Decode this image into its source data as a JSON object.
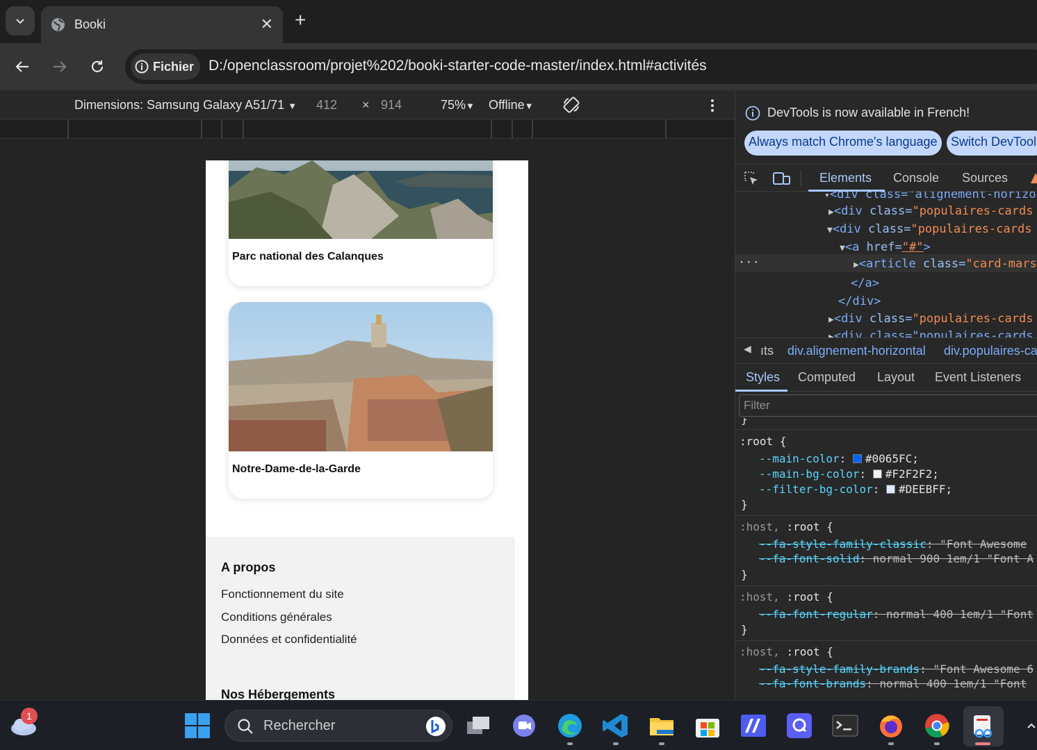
{
  "browser": {
    "tab_title": "Booki",
    "chip_label": "Fichier",
    "url": "D:/openclassroom/projet%202/booki-starter-code-master/index.html#activités"
  },
  "device_toolbar": {
    "dimensions_label": "Dimensions: Samsung Galaxy A51/71",
    "width": "412",
    "times": "×",
    "height": "914",
    "zoom": "75%",
    "throttle": "Offline"
  },
  "page": {
    "cards": [
      {
        "name": "Parc national des Calanques"
      },
      {
        "name": "Notre-Dame-de-la-Garde"
      }
    ],
    "footer": {
      "heading1": "A propos",
      "links": [
        "Fonctionnement du site",
        "Conditions générales",
        "Données et confidentialité"
      ],
      "heading2": "Nos Hébergements"
    }
  },
  "devtools": {
    "info_message": "DevTools is now available in French!",
    "btn_match": "Always match Chrome's language",
    "btn_switch": "Switch DevTools",
    "tabs": [
      "Elements",
      "Console",
      "Sources"
    ],
    "elements": {
      "line0": "<div class=\"alignement-horizont",
      "line1_tag": "<div",
      "line1_attr": "class=",
      "line1_val": "\"populaires-cards",
      "line2_val": "\"populaires-cards",
      "line3_tag": "<a",
      "line3_attr": "href=",
      "line3_val": "\"#\"",
      "line3_end": ">",
      "line4_tag": "<article",
      "line4_val": "\"card-marse",
      "line5": "</a>",
      "line6": "</div>",
      "line7_val": "\"populaires-cards",
      "line8": "<div class=\"populaires-cards"
    },
    "breadcrumbs": [
      "ıts",
      "div.alignement-horizontal",
      "div.populaires-ca"
    ],
    "subtabs": [
      "Styles",
      "Computed",
      "Layout",
      "Event Listeners"
    ],
    "filter_placeholder": "Filter",
    "styles": {
      "brace_top": "}",
      "root_selector": ":root {",
      "vars": [
        {
          "name": "--main-color",
          "value": "#0065FC",
          "color": "#0065FC"
        },
        {
          "name": "--main-bg-color",
          "value": "#F2F2F2",
          "color": "#F2F2F2"
        },
        {
          "name": "--filter-bg-color",
          "value": "#DEEBFF",
          "color": "#DEEBFF"
        }
      ],
      "close": "}",
      "host": ":host,",
      "root": ":root {",
      "rule2": [
        {
          "name": "--fa-style-family-classic",
          "value": "\"Font Awesome"
        },
        {
          "name": "--fa-font-solid",
          "value": "normal 900 1em/1 \"Font A"
        }
      ],
      "rule3": [
        {
          "name": "--fa-font-regular",
          "value": "normal 400 1em/1 \"Font"
        }
      ],
      "rule4": [
        {
          "name": "--fa-style-family-brands",
          "value": "\"Font Awesome 6"
        },
        {
          "name": "--fa-font-brands",
          "value": "normal 400 1em/1 \"Font"
        }
      ]
    }
  },
  "taskbar": {
    "search_placeholder": "Rechercher",
    "weather_badge": "1"
  }
}
